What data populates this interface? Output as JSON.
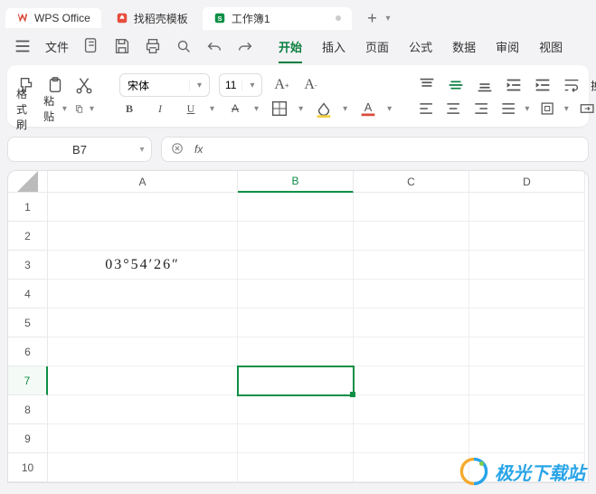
{
  "title_tabs": {
    "app": "WPS Office",
    "template": "找稻壳模板",
    "workbook": "工作簿1"
  },
  "menu": {
    "file": "文件",
    "tabs": [
      "开始",
      "插入",
      "页面",
      "公式",
      "数据",
      "审阅",
      "视图"
    ],
    "active_index": 0
  },
  "ribbon": {
    "format_painter": "格式刷",
    "paste": "粘贴",
    "font_name": "宋体",
    "font_size": "11",
    "wrap": "换行",
    "merge": "合并"
  },
  "namebox": {
    "value": "B7"
  },
  "formula_bar": {
    "fx": "fx",
    "value": ""
  },
  "grid": {
    "columns": [
      "A",
      "B",
      "C",
      "D"
    ],
    "rows": [
      1,
      2,
      3,
      4,
      5,
      6,
      7,
      8,
      9,
      10
    ],
    "selected": {
      "col": "B",
      "row": 7
    },
    "cells": {
      "A3": "03°54′26″"
    }
  },
  "watermark": "极光下载站"
}
